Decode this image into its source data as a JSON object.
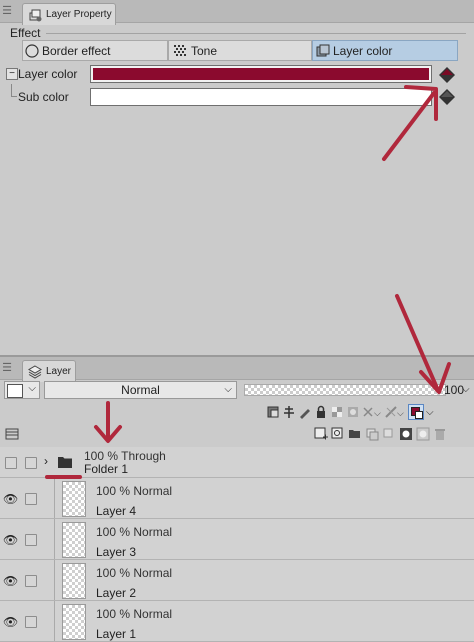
{
  "property_panel": {
    "tab_title": "Layer Property",
    "effect_label": "Effect",
    "effects": [
      {
        "label": "Border effect",
        "selected": false
      },
      {
        "label": "Tone",
        "selected": false
      },
      {
        "label": "Layer color",
        "selected": true
      }
    ],
    "layer_color_label": "Layer color",
    "layer_color_value": "#8b0a2e",
    "sub_color_label": "Sub color",
    "sub_color_value": "#ffffff"
  },
  "layer_panel": {
    "tab_title": "Layer",
    "blend_mode": "Normal",
    "opacity": "100",
    "layers": [
      {
        "mode": "100 % Through",
        "name": "Folder 1",
        "type": "folder"
      },
      {
        "mode": "100 % Normal",
        "name": "Layer 4",
        "type": "raster"
      },
      {
        "mode": "100 % Normal",
        "name": "Layer 3",
        "type": "raster"
      },
      {
        "mode": "100 % Normal",
        "name": "Layer 2",
        "type": "raster"
      },
      {
        "mode": "100 % Normal",
        "name": "Layer 1",
        "type": "raster"
      }
    ]
  },
  "colors": {
    "annotation_arrow": "#b0283c",
    "selected_segment": "#b6cde3",
    "layer_color": "#8b0a2e"
  }
}
